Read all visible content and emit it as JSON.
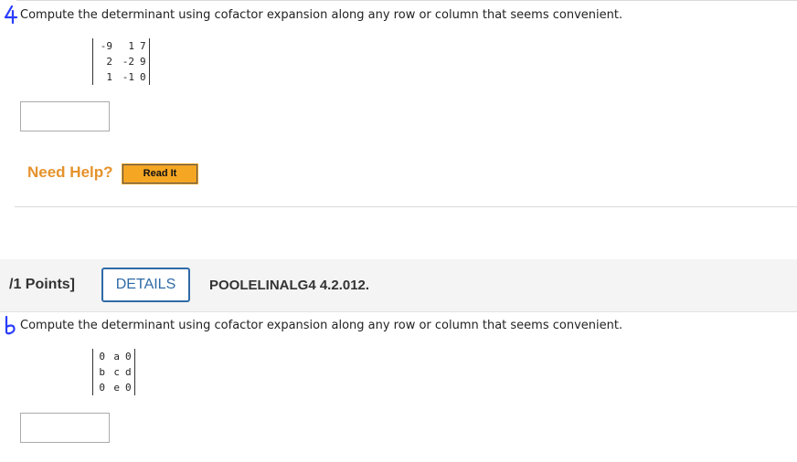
{
  "q4": {
    "handwritten_number": "4",
    "prompt": "Compute the determinant using cofactor expansion along any row or column that seems convenient.",
    "matrix": [
      [
        "-9",
        "1",
        "7"
      ],
      [
        "2",
        "-2",
        "9"
      ],
      [
        "1",
        "-1",
        "0"
      ]
    ],
    "need_help": "Need Help?",
    "read_it": "Read It"
  },
  "q5": {
    "points": "/1 Points]",
    "details": "DETAILS",
    "problem_id": "POOLELINALG4 4.2.012.",
    "handwritten_number": "5",
    "prompt": "Compute the determinant using cofactor expansion along any row or column that seems convenient.",
    "matrix": [
      [
        "0",
        "a",
        "0"
      ],
      [
        "b",
        "c",
        "d"
      ],
      [
        "0",
        "e",
        "0"
      ]
    ]
  },
  "colors": {
    "handwriting": "#2a3cff",
    "help_orange": "#e5922b",
    "read_it_bg": "#f5a623",
    "details_blue": "#2f6aa7"
  }
}
